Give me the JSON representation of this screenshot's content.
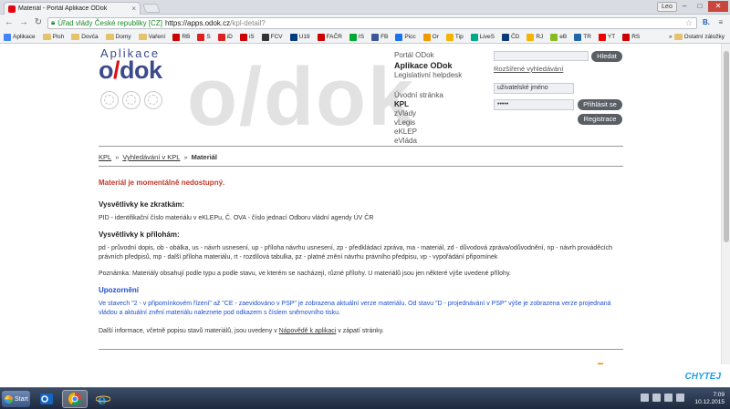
{
  "browser": {
    "tab_title": "Materiál - Portál Aplikace ODok",
    "tab_close": "×",
    "user_label": "Leo",
    "min": "–",
    "max": "□",
    "close": "✕",
    "ev_name": "Úřad vlády České republiky [CZ]",
    "url_host": "https://apps.odok.cz",
    "url_path": "/kpl-detail?",
    "back": "←",
    "forward": "→",
    "reload": "↻",
    "star": "☆",
    "ext_b": "B.",
    "menu": "≡"
  },
  "bookmarks": {
    "items": [
      {
        "label": "Aplikace",
        "color": "#4285f4"
      },
      {
        "label": "Pish",
        "color": "folder"
      },
      {
        "label": "Dovča",
        "color": "folder"
      },
      {
        "label": "Domy",
        "color": "folder"
      },
      {
        "label": "Vaření",
        "color": "folder"
      },
      {
        "label": "RB",
        "color": "#c00"
      },
      {
        "label": "S",
        "color": "#d22"
      },
      {
        "label": "iD",
        "color": "#d22"
      },
      {
        "label": "iS",
        "color": "#c00"
      },
      {
        "label": "FCV",
        "color": "#333"
      },
      {
        "label": "U19",
        "color": "#003a80"
      },
      {
        "label": "FAČR",
        "color": "#c00"
      },
      {
        "label": "IS",
        "color": "#0a3"
      },
      {
        "label": "FB",
        "color": "#3b5998"
      },
      {
        "label": "Picc",
        "color": "#1a73e8"
      },
      {
        "label": "Or",
        "color": "#f29900"
      },
      {
        "label": "Tip",
        "color": "#f4b400"
      },
      {
        "label": "LiveS",
        "color": "#0a8"
      },
      {
        "label": "ČD",
        "color": "#0c3c78"
      },
      {
        "label": "RJ",
        "color": "#f4b400"
      },
      {
        "label": "eB",
        "color": "#8b2"
      },
      {
        "label": "TR",
        "color": "#26a"
      },
      {
        "label": "YT",
        "color": "#e00"
      },
      {
        "label": "RS",
        "color": "#c00"
      }
    ],
    "more": "»",
    "other": "Ostatní záložky"
  },
  "header": {
    "logo_small": "Aplikace",
    "logo_big_o": "o",
    "logo_big_slash": "/",
    "logo_big_dok": "dok",
    "watermark": "o/dok",
    "portal_label": "Portál ODok",
    "portal_name": "Aplikace ODok",
    "portal_sub": "Legislativní helpdesk",
    "nav": [
      {
        "label": "Úvodní stránka",
        "active": false
      },
      {
        "label": "KPL",
        "active": true
      },
      {
        "label": "zVlády",
        "active": false
      },
      {
        "label": "vLegis",
        "active": false
      },
      {
        "label": "eKLEP",
        "active": false
      },
      {
        "label": "eVláda",
        "active": false
      }
    ],
    "search_button": "Hledat",
    "adv_search": "Rozšířené vyhledávání",
    "username_placeholder": "uživatelské jméno",
    "password_value": "•••••",
    "login_button": "Přihlásit se",
    "register_button": "Registrace"
  },
  "breadcrumb": {
    "items": [
      "KPL",
      "Vyhledávání v KPL"
    ],
    "current": "Materiál",
    "sep": "»"
  },
  "content": {
    "warning": "Materiál je momentálně nedostupný.",
    "abbr_title": "Vysvětlivky ke zkratkám:",
    "abbr_text": "PID - identifikační číslo materiálu v eKLEPu, Č. OVA - číslo jednací Odboru vládní agendy ÚV ČR",
    "att_title": "Vysvětlivky k přílohám:",
    "att_text": "pd - průvodní dopis, ob - obálka, us - návrh usnesení, up - příloha návrhu usnesení, zp - předkládací zpráva, ma - materiál, zd - důvodová zpráva/odůvodnění, np - návrh prováděcích právních předpisů, mp - další příloha materiálu, rt - rozdílová tabulka, pz - platné znění návrhu právního předpisu, vp - vypořádání připomínek",
    "note": "Poznámka: Materiály obsahují podle typu a podle stavu, ve kterém se nacházejí, různé přílohy. U materiálů jsou jen některé výše uvedené přílohy.",
    "notice_title": "Upozornění",
    "notice_text": "Ve stavech \"2 - v připomínkovém řízení\" až \"CE - zaevidováno v PSP\" je zobrazena aktuální verze materiálu. Od stavu \"D - projednávání v PSP\" výše je zobrazena verze projednaná vládou a aktuální znění materiálu naleznete pod odkazem s číslem sněmovního tisku.",
    "more_info_prefix": "Další informace, včetně popisu stavů materiálů, jsou uvedeny v ",
    "more_info_link": "Nápovědě k aplikaci",
    "more_info_suffix": " v zápatí stránky."
  },
  "taskbar": {
    "start": "Start",
    "time": "7:09",
    "date": "10.12.2015",
    "watermark": "CHYTEJ"
  }
}
